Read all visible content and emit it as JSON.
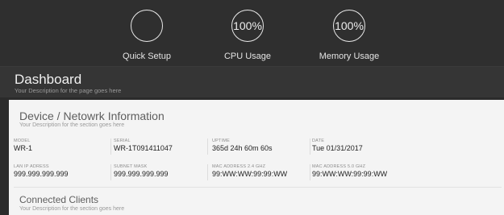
{
  "stats": [
    {
      "value": "",
      "label": "Quick Setup"
    },
    {
      "value": "100%",
      "label": "CPU Usage"
    },
    {
      "value": "100%",
      "label": "Memory Usage"
    }
  ],
  "page": {
    "title": "Dashboard",
    "description": "Your Description for the page goes here"
  },
  "device_section": {
    "title": "Device / Netowrk Information",
    "description": "Your Description for the section goes here",
    "fields": [
      {
        "key": "MODEL",
        "value": "WR-1"
      },
      {
        "key": "SERIAL",
        "value": "WR-1T091411047"
      },
      {
        "key": "UPTIME",
        "value": "365d 24h 60m 60s"
      },
      {
        "key": "DATE",
        "value": "Tue 01/31/2017"
      },
      {
        "key": "LAN IP ADRESS",
        "value": "999.999.999.999"
      },
      {
        "key": "SUBNET MASK",
        "value": "999.999.999.999"
      },
      {
        "key": "MAC ADDRESS 2.4 GHZ",
        "value": "99:WW:WW:99:99:WW"
      },
      {
        "key": "MAC ADDRESS 5.0 GHZ",
        "value": "99:WW:WW:99:99:WW"
      }
    ]
  },
  "clients_section": {
    "title": "Connected Clients",
    "description": "Your Description for the section goes here"
  }
}
